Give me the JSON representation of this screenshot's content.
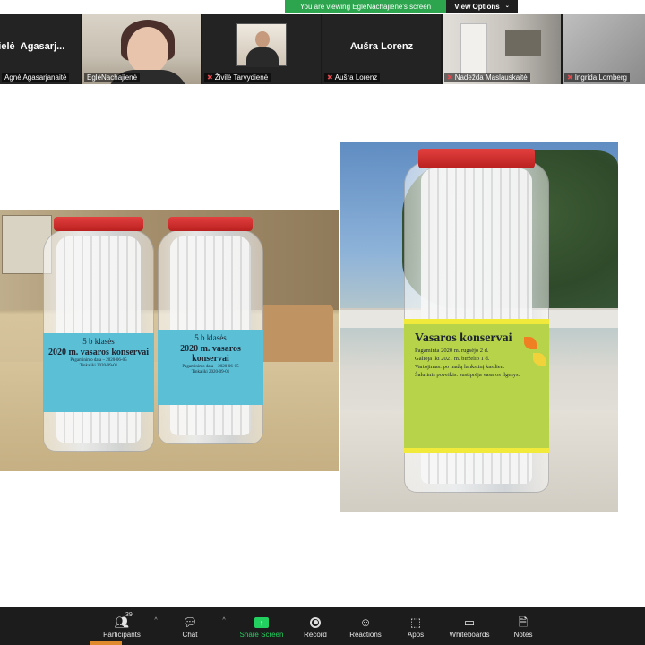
{
  "banner": {
    "viewing_text": "You are viewing EglėNachajienė's screen",
    "view_options_label": "View Options",
    "view_options_caret": "⌄"
  },
  "participants": [
    {
      "name": "Agnė Agasarjanaitė",
      "big_name": "Agasarj...",
      "big_prefix": "rielė",
      "muted": false,
      "video": false
    },
    {
      "name": "EglėNachajienė",
      "muted": false,
      "video": true
    },
    {
      "name": "Živilė Tarvydienė",
      "muted": true,
      "video": true
    },
    {
      "name": "Aušra Lorenz",
      "big_name": "Aušra Lorenz",
      "muted": true,
      "video": false
    },
    {
      "name": "Nadežda Maslauskaitė",
      "muted": true,
      "video": true
    },
    {
      "name": "Ingrida Lomberg",
      "muted": true,
      "video": true
    }
  ],
  "slide": {
    "jar_left": {
      "class_label": "5 b klasės",
      "title": "2020 m. vasaros konservai",
      "line1": "Pagaminimo data – 2020-06-05",
      "line2": "Tinka iki 2020-09-01"
    },
    "jar_middle": {
      "class_label": "5 b klasės",
      "title": "2020 m. vasaros konservai",
      "line1": "Pagaminimo data – 2020-06-05",
      "line2": "Tinka iki 2020-09-01"
    },
    "jar_right": {
      "title": "Vasaros konservai",
      "line1": "Pagaminta 2020 m. rugsėjo 2 d.",
      "line2": "Galioja iki 2021 m. birželio 1 d.",
      "line3": "Vartojimas: po mažą lankstinį kasdien.",
      "line4": "Šalutinis poveikis: sustiprėja vasaros ilgesys."
    }
  },
  "toolbar": {
    "participants_label": "Participants",
    "participants_count": "39",
    "chat_label": "Chat",
    "share_label": "Share Screen",
    "record_label": "Record",
    "reactions_label": "Reactions",
    "apps_label": "Apps",
    "whiteboards_label": "Whiteboards",
    "notes_label": "Notes",
    "caret": "^"
  },
  "colors": {
    "share_green": "#23d160",
    "banner_green": "#2da44e",
    "muted_red": "#e5484d",
    "toolbar_bg": "#1c1c1c"
  },
  "icons": {
    "participants": "people-icon",
    "chat": "chat-bubble-icon",
    "share": "share-screen-icon",
    "record": "record-icon",
    "reactions": "smiley-icon",
    "apps": "apps-icon",
    "whiteboards": "whiteboard-icon",
    "notes": "notes-icon"
  }
}
